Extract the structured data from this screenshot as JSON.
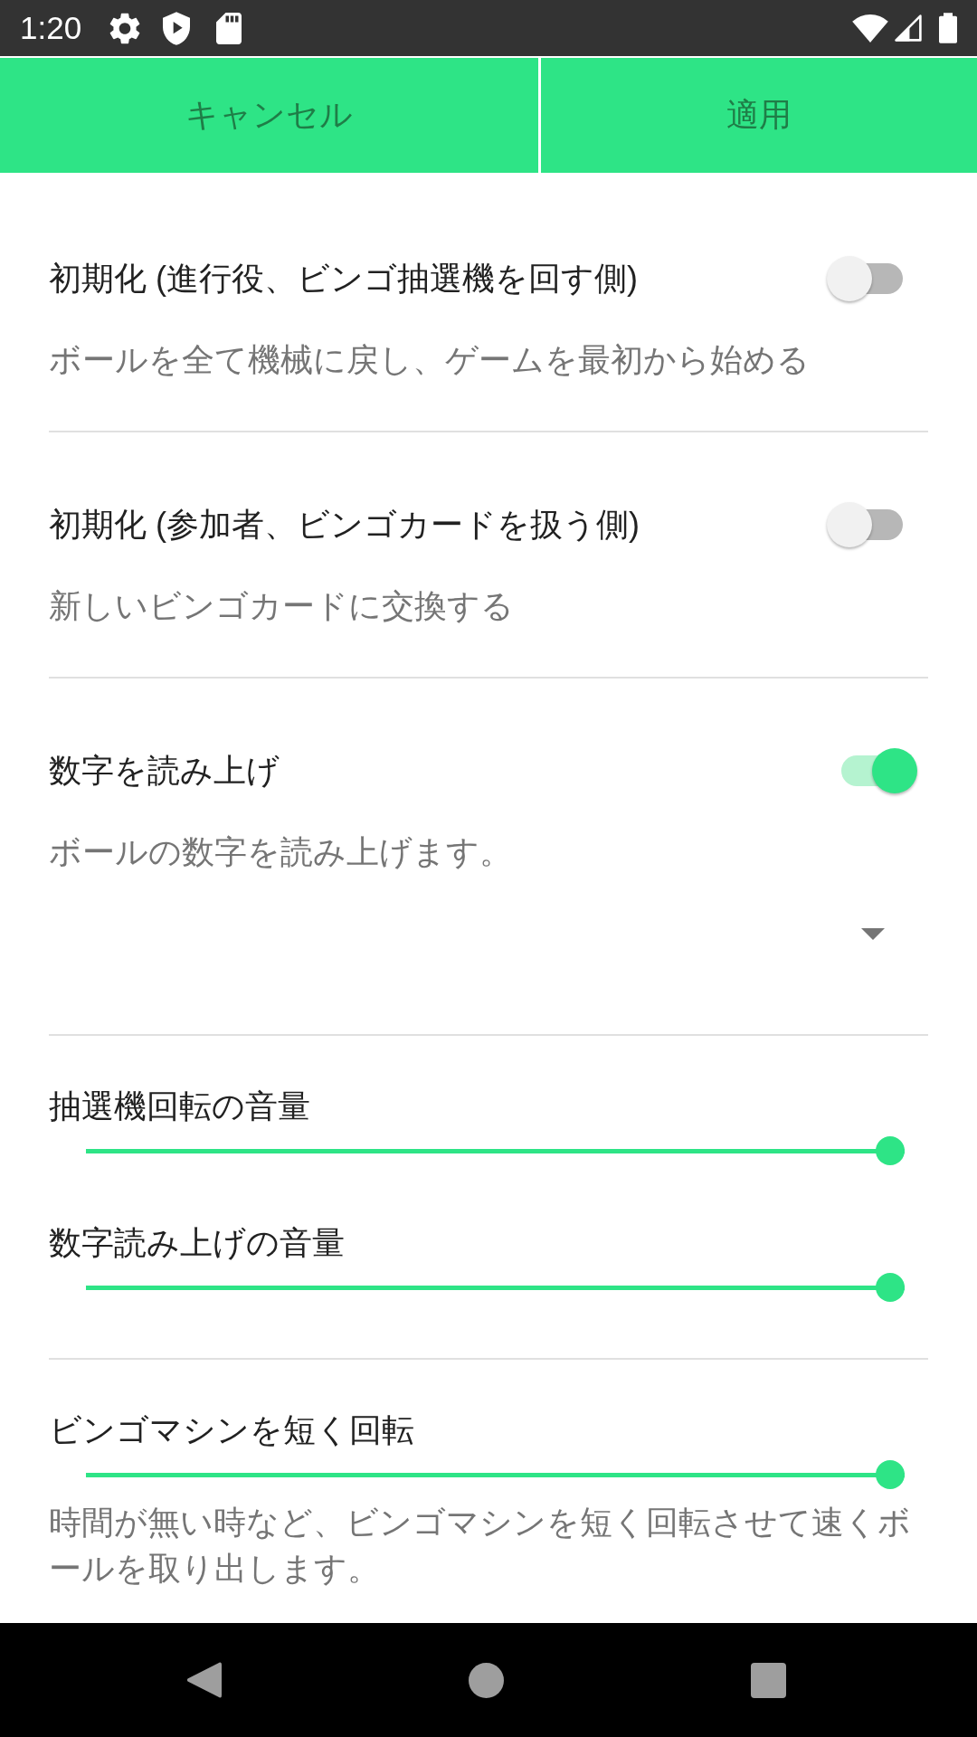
{
  "status_bar": {
    "time": "1:20"
  },
  "action_bar": {
    "cancel": "キャンセル",
    "apply": "適用"
  },
  "sections": [
    {
      "items": [
        {
          "kind": "switch",
          "title": "初期化 (進行役、ビンゴ抽選機を回す側)",
          "summary": "ボールを全て機械に戻し、ゲームを最初から始める",
          "on": false
        }
      ]
    },
    {
      "items": [
        {
          "kind": "switch",
          "title": "初期化 (参加者、ビンゴカードを扱う側)",
          "summary": "新しいビンゴカードに交換する",
          "on": false
        }
      ]
    },
    {
      "items": [
        {
          "kind": "switch",
          "title": "数字を読み上げ",
          "summary": "ボールの数字を読み上げます。",
          "on": true
        },
        {
          "kind": "dropdown"
        }
      ]
    },
    {
      "items": [
        {
          "kind": "slider",
          "title": "抽選機回転の音量",
          "level": 1
        },
        {
          "kind": "slider",
          "title": "数字読み上げの音量",
          "level": 1
        }
      ]
    },
    {
      "items": [
        {
          "kind": "slider",
          "title": "ビンゴマシンを短く回転",
          "level": 1,
          "summary": "時間が無い時など、ビンゴマシンを短く回転させて速くボールを取り出します。"
        }
      ]
    }
  ]
}
